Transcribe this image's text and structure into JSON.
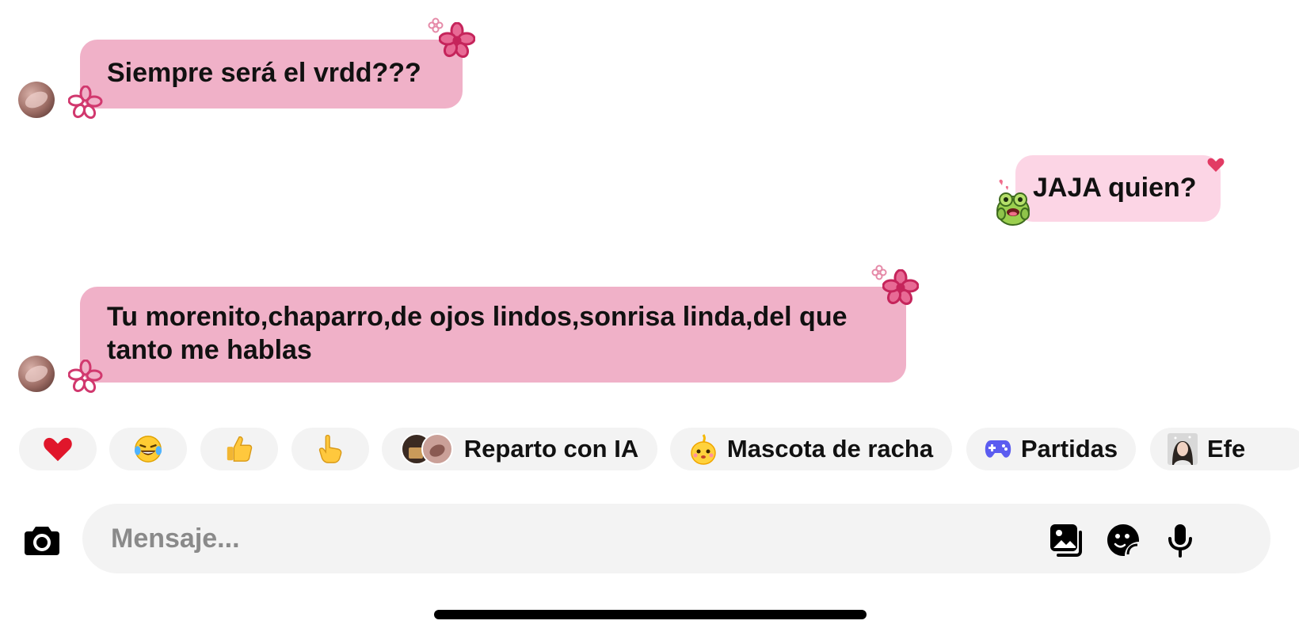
{
  "messages": [
    {
      "direction": "incoming",
      "text": "Siempre será el vrdd???"
    },
    {
      "direction": "outgoing",
      "text": "JAJA quien?"
    },
    {
      "direction": "incoming",
      "text": "Tu morenito,chaparro,de ojos lindos,sonrisa linda,del que tanto me hablas"
    }
  ],
  "quick_replies": [
    {
      "icon": "heart-emoji",
      "glyph": "❤️",
      "label": ""
    },
    {
      "icon": "laughing-tears-emoji",
      "glyph": "😂",
      "label": ""
    },
    {
      "icon": "thumbs-up-emoji",
      "glyph": "👍",
      "label": ""
    },
    {
      "icon": "pointing-up-emoji",
      "glyph": "👆",
      "label": ""
    },
    {
      "icon": "ai-cast-avatars",
      "glyph": "",
      "label": "Reparto con IA"
    },
    {
      "icon": "streak-mascot-icon",
      "glyph": "",
      "label": "Mascota de racha"
    },
    {
      "icon": "gamepad-icon",
      "glyph": "",
      "label": "Partidas"
    },
    {
      "icon": "effects-avatar-icon",
      "glyph": "",
      "label": "Efe"
    }
  ],
  "composer": {
    "placeholder": "Mensaje...",
    "camera_icon": "camera-icon",
    "gallery_icon": "gallery-icon",
    "sticker_icon": "sticker-icon",
    "mic_icon": "microphone-icon"
  },
  "colors": {
    "incoming_bubble": "#f0b1c8",
    "outgoing_bubble": "#fcd5e5",
    "flower_deco": "#d1386e",
    "chip_background": "#f3f3f3",
    "gamepad": "#5b5cf0"
  }
}
